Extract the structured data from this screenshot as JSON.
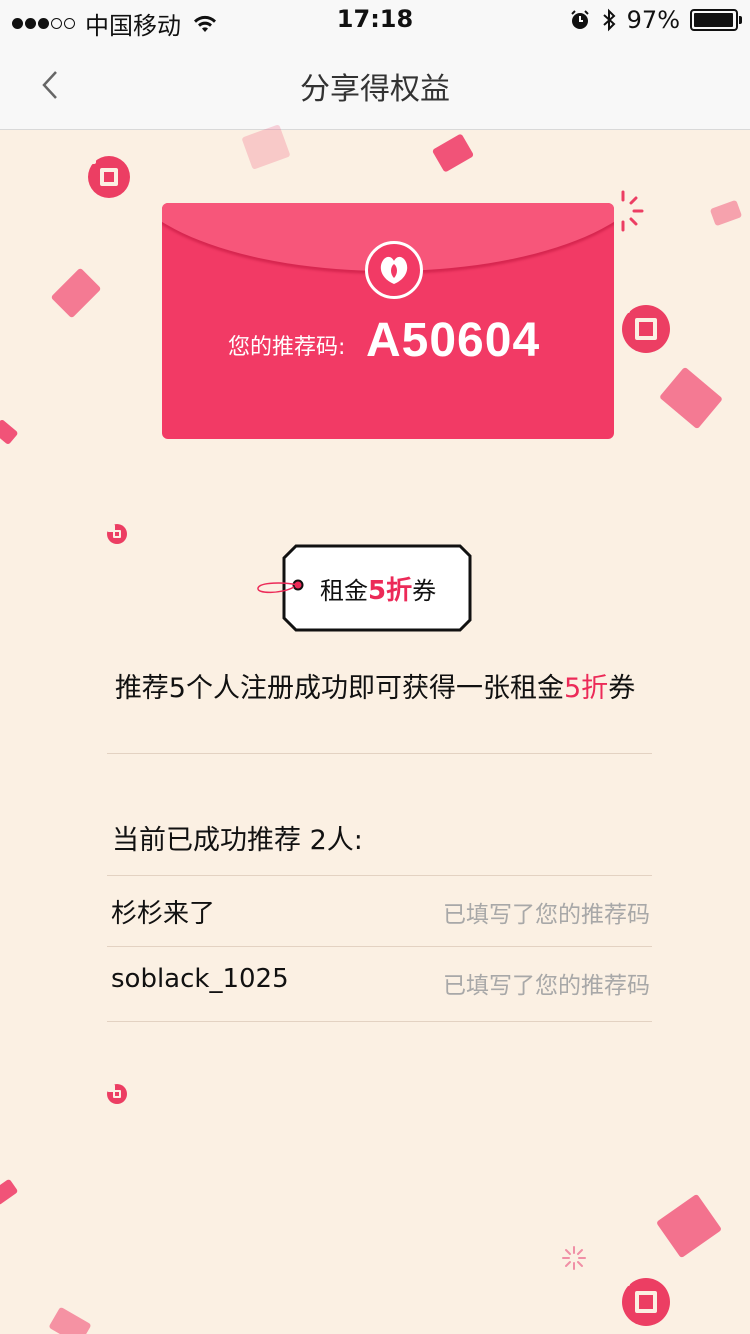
{
  "status_bar": {
    "carrier": "中国移动",
    "time": "17:18",
    "battery": "97%",
    "battery_level": 0.97
  },
  "nav": {
    "title": "分享得权益"
  },
  "envelope": {
    "label": "您的推荐码:",
    "code": "A50604"
  },
  "coupon_tag": {
    "prefix": "租金",
    "highlight": "5折",
    "suffix": "券"
  },
  "promo": {
    "part1": "推荐5个人注册成功即可获得一张租金",
    "highlight": "5折",
    "part2": "券"
  },
  "referrals": {
    "heading": "当前已成功推荐 2人:",
    "items": [
      {
        "name": "杉杉来了",
        "status": "已填写了您的推荐码"
      },
      {
        "name": "soblack_1025",
        "status": "已填写了您的推荐码"
      }
    ]
  },
  "colors": {
    "accent": "#EC2A58",
    "envelope": "#F23A65",
    "background": "#FBF0E3"
  }
}
